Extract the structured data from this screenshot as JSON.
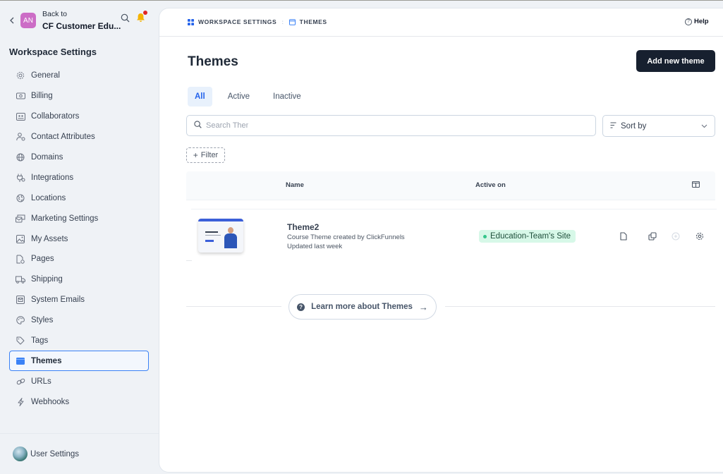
{
  "sidebar": {
    "back_label": "Back to",
    "workspace_avatar_initials": "AN",
    "workspace_name": "CF Customer Edu...",
    "title": "Workspace Settings",
    "items": [
      {
        "label": "General",
        "icon": "gear-icon"
      },
      {
        "label": "Billing",
        "icon": "banknote-icon"
      },
      {
        "label": "Collaborators",
        "icon": "users-card-icon"
      },
      {
        "label": "Contact Attributes",
        "icon": "user-settings-icon"
      },
      {
        "label": "Domains",
        "icon": "globe-icon"
      },
      {
        "label": "Integrations",
        "icon": "plug-icon"
      },
      {
        "label": "Locations",
        "icon": "world-icon"
      },
      {
        "label": "Marketing Settings",
        "icon": "mail-stack-icon"
      },
      {
        "label": "My Assets",
        "icon": "image-icon"
      },
      {
        "label": "Pages",
        "icon": "page-icon"
      },
      {
        "label": "Shipping",
        "icon": "truck-icon"
      },
      {
        "label": "System Emails",
        "icon": "email-box-icon"
      },
      {
        "label": "Styles",
        "icon": "palette-icon"
      },
      {
        "label": "Tags",
        "icon": "tag-icon"
      },
      {
        "label": "Themes",
        "icon": "theme-window-icon",
        "active": true
      },
      {
        "label": "URLs",
        "icon": "link-icon"
      },
      {
        "label": "Webhooks",
        "icon": "bolt-icon"
      }
    ],
    "user_settings_label": "User Settings"
  },
  "header": {
    "breadcrumb": [
      {
        "label": "WORKSPACE SETTINGS",
        "icon": "grid-icon"
      },
      {
        "label": "THEMES",
        "icon": "window-icon"
      }
    ],
    "breadcrumb_separator": ":",
    "help_label": "Help"
  },
  "main": {
    "title": "Themes",
    "add_button_label": "Add new theme",
    "tabs": [
      {
        "label": "All",
        "active": true
      },
      {
        "label": "Active"
      },
      {
        "label": "Inactive"
      }
    ],
    "search": {
      "placeholder": "Search Themes",
      "value": ""
    },
    "sort": {
      "label": "Sort by"
    },
    "filter_label": "Filter",
    "table": {
      "columns": [
        "",
        "Name",
        "Active on"
      ],
      "rows": [
        {
          "name": "Theme2",
          "description": "Course Theme created by ClickFunnels",
          "updated": "Updated last week",
          "active_on": "Education-Team's Site",
          "actions": [
            "page-icon",
            "duplicate-icon",
            "add-circle-icon",
            "gear-icon"
          ]
        }
      ]
    },
    "learn_more_label": "Learn more about Themes"
  },
  "colors": {
    "accent": "#3b82f6",
    "primary_button": "#17202f",
    "badge_bg": "#d7f8e8",
    "badge_dot": "#34c58a",
    "notification": "#e02424",
    "workspace_avatar": "#cc6dc6"
  }
}
